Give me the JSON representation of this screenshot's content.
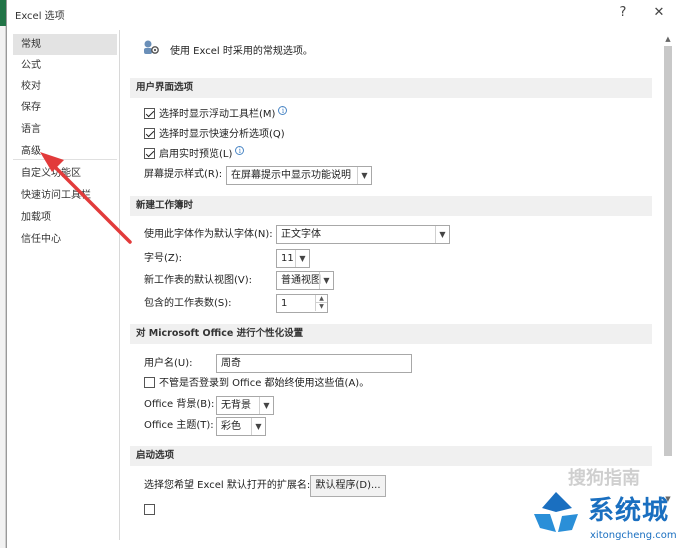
{
  "window": {
    "title": "Excel 选项",
    "help": "?",
    "close": "✕"
  },
  "nav": {
    "items": [
      "常规",
      "公式",
      "校对",
      "保存",
      "语言",
      "高级",
      "自定义功能区",
      "快速访问工具栏",
      "加载项",
      "信任中心"
    ],
    "active_index": 0
  },
  "intro": {
    "text": "使用 Excel 时采用的常规选项。"
  },
  "ui_options": {
    "header": "用户界面选项",
    "mini_toolbar": {
      "label": "选择时显示浮动工具栏(M)",
      "checked": true
    },
    "quick_analysis": {
      "label": "选择时显示快速分析选项(Q)",
      "checked": true
    },
    "live_preview": {
      "label": "启用实时预览(L)",
      "checked": true
    },
    "screentip_label": "屏幕提示样式(R):",
    "screentip_value": "在屏幕提示中显示功能说明"
  },
  "new_workbook": {
    "header": "新建工作簿时",
    "font_label": "使用此字体作为默认字体(N):",
    "font_value": "正文字体",
    "size_label": "字号(Z):",
    "size_value": "11",
    "view_label": "新工作表的默认视图(V):",
    "view_value": "普通视图",
    "sheets_label": "包含的工作表数(S):",
    "sheets_value": "1"
  },
  "personalize": {
    "header": "对 Microsoft Office 进行个性化设置",
    "username_label": "用户名(U):",
    "username_value": "周奇",
    "always_use": {
      "label": "不管是否登录到 Office 都始终使用这些值(A)。",
      "checked": false
    },
    "background_label": "Office 背景(B):",
    "background_value": "无背景",
    "theme_label": "Office 主题(T):",
    "theme_value": "彩色"
  },
  "startup": {
    "header": "启动选项",
    "ext_label": "选择您希望 Excel 默认打开的扩展名:",
    "default_programs_button": "默认程序(D)..."
  },
  "watermark": {
    "brand": "系统城",
    "url": "xitongcheng.com",
    "faint": "搜狗指南"
  },
  "colors": {
    "accent": "#217346",
    "arrow": "#e23b3b",
    "watermark": "#1a6fc0"
  }
}
